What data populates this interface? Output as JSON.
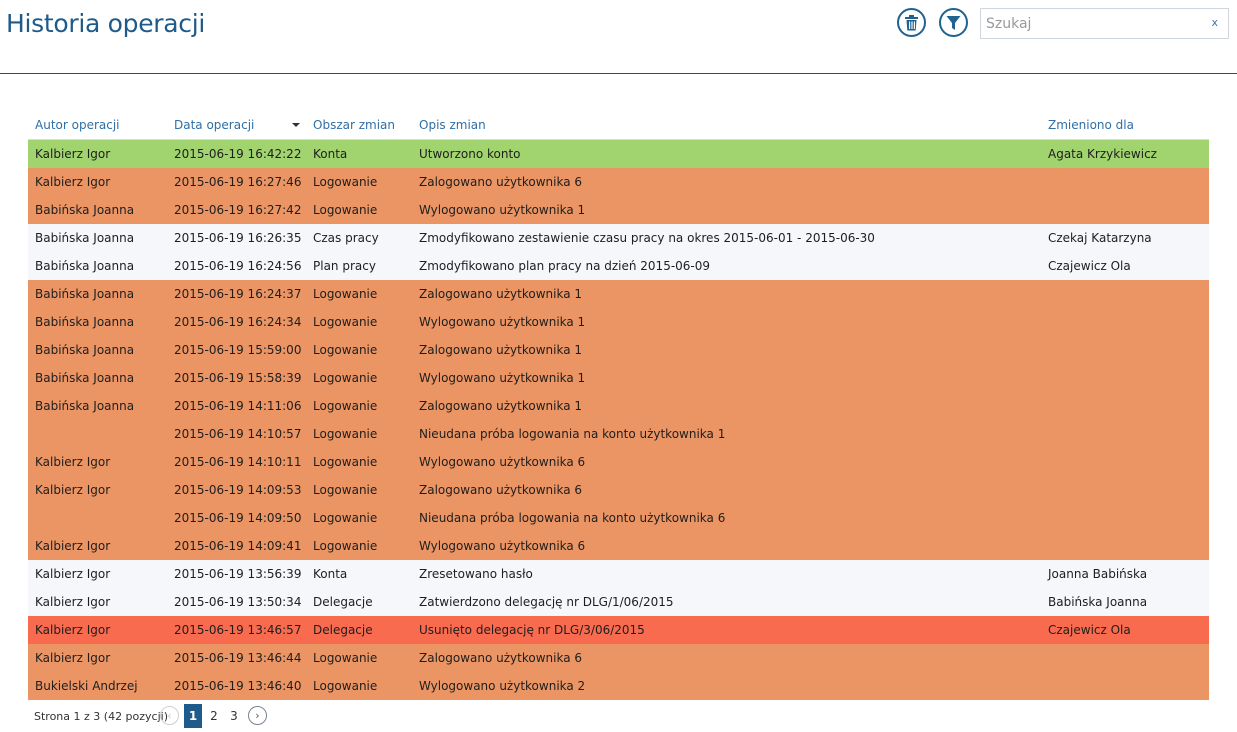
{
  "header": {
    "title": "Historia operacji",
    "search_placeholder": "Szukaj",
    "search_value": "",
    "search_clear": "x"
  },
  "colors": {
    "title": "#1f5b8a",
    "header_text": "#2f6fa5",
    "row_green": "#a1d46f",
    "row_orange": "#ec9564",
    "row_white": "#f6f7fb",
    "row_red": "#f96b4f"
  },
  "icons": {
    "trash": "trash-icon",
    "filter": "filter-icon",
    "sort": "sort-descending-icon",
    "prev": "chevron-left-icon",
    "next": "chevron-right-icon"
  },
  "table": {
    "columns": {
      "author": "Autor operacji",
      "date": "Data operacji",
      "area": "Obszar zmian",
      "description": "Opis zmian",
      "changed_for": "Zmieniono dla"
    },
    "sorted_by": "date",
    "sort_direction": "desc",
    "rows": [
      {
        "status": "green",
        "author": "Kalbierz Igor",
        "date": "2015-06-19 16:42:22",
        "area": "Konta",
        "description": "Utworzono konto",
        "changed_for": "Agata Krzykiewicz"
      },
      {
        "status": "orange",
        "author": "Kalbierz Igor",
        "date": "2015-06-19 16:27:46",
        "area": "Logowanie",
        "description": "Zalogowano użytkownika 6",
        "changed_for": ""
      },
      {
        "status": "orange",
        "author": "Babińska Joanna",
        "date": "2015-06-19 16:27:42",
        "area": "Logowanie",
        "description": "Wylogowano użytkownika 1",
        "changed_for": ""
      },
      {
        "status": "white",
        "author": "Babińska Joanna",
        "date": "2015-06-19 16:26:35",
        "area": "Czas pracy",
        "description": "Zmodyfikowano zestawienie czasu pracy na okres 2015-06-01 - 2015-06-30",
        "changed_for": "Czekaj Katarzyna"
      },
      {
        "status": "white",
        "author": "Babińska Joanna",
        "date": "2015-06-19 16:24:56",
        "area": "Plan pracy",
        "description": "Zmodyfikowano plan pracy na dzień 2015-06-09",
        "changed_for": "Czajewicz Ola"
      },
      {
        "status": "orange",
        "author": "Babińska Joanna",
        "date": "2015-06-19 16:24:37",
        "area": "Logowanie",
        "description": "Zalogowano użytkownika 1",
        "changed_for": ""
      },
      {
        "status": "orange",
        "author": "Babińska Joanna",
        "date": "2015-06-19 16:24:34",
        "area": "Logowanie",
        "description": "Wylogowano użytkownika 1",
        "changed_for": ""
      },
      {
        "status": "orange",
        "author": "Babińska Joanna",
        "date": "2015-06-19 15:59:00",
        "area": "Logowanie",
        "description": "Zalogowano użytkownika 1",
        "changed_for": ""
      },
      {
        "status": "orange",
        "author": "Babińska Joanna",
        "date": "2015-06-19 15:58:39",
        "area": "Logowanie",
        "description": "Wylogowano użytkownika 1",
        "changed_for": ""
      },
      {
        "status": "orange",
        "author": "Babińska Joanna",
        "date": "2015-06-19 14:11:06",
        "area": "Logowanie",
        "description": "Zalogowano użytkownika 1",
        "changed_for": ""
      },
      {
        "status": "orange",
        "author": "",
        "date": "2015-06-19 14:10:57",
        "area": "Logowanie",
        "description": "Nieudana próba logowania na konto użytkownika 1",
        "changed_for": ""
      },
      {
        "status": "orange",
        "author": "Kalbierz Igor",
        "date": "2015-06-19 14:10:11",
        "area": "Logowanie",
        "description": "Wylogowano użytkownika 6",
        "changed_for": ""
      },
      {
        "status": "orange",
        "author": "Kalbierz Igor",
        "date": "2015-06-19 14:09:53",
        "area": "Logowanie",
        "description": "Zalogowano użytkownika 6",
        "changed_for": ""
      },
      {
        "status": "orange",
        "author": "",
        "date": "2015-06-19 14:09:50",
        "area": "Logowanie",
        "description": "Nieudana próba logowania na konto użytkownika 6",
        "changed_for": ""
      },
      {
        "status": "orange",
        "author": "Kalbierz Igor",
        "date": "2015-06-19 14:09:41",
        "area": "Logowanie",
        "description": "Wylogowano użytkownika 6",
        "changed_for": ""
      },
      {
        "status": "white",
        "author": "Kalbierz Igor",
        "date": "2015-06-19 13:56:39",
        "area": "Konta",
        "description": "Zresetowano hasło",
        "changed_for": "Joanna Babińska"
      },
      {
        "status": "white",
        "author": "Kalbierz Igor",
        "date": "2015-06-19 13:50:34",
        "area": "Delegacje",
        "description": "Zatwierdzono delegację nr DLG/1/06/2015",
        "changed_for": "Babińska Joanna"
      },
      {
        "status": "red",
        "author": "Kalbierz Igor",
        "date": "2015-06-19 13:46:57",
        "area": "Delegacje",
        "description": "Usunięto delegację nr DLG/3/06/2015",
        "changed_for": "Czajewicz Ola"
      },
      {
        "status": "orange",
        "author": "Kalbierz Igor",
        "date": "2015-06-19 13:46:44",
        "area": "Logowanie",
        "description": "Zalogowano użytkownika 6",
        "changed_for": ""
      },
      {
        "status": "orange",
        "author": "Bukielski Andrzej",
        "date": "2015-06-19 13:46:40",
        "area": "Logowanie",
        "description": "Wylogowano użytkownika 2",
        "changed_for": ""
      }
    ]
  },
  "pager": {
    "info": "Strona 1 z 3 (42 pozycji)",
    "prev_symbol": "‹",
    "next_symbol": "›",
    "pages": [
      "1",
      "2",
      "3"
    ],
    "current_page": "1"
  }
}
